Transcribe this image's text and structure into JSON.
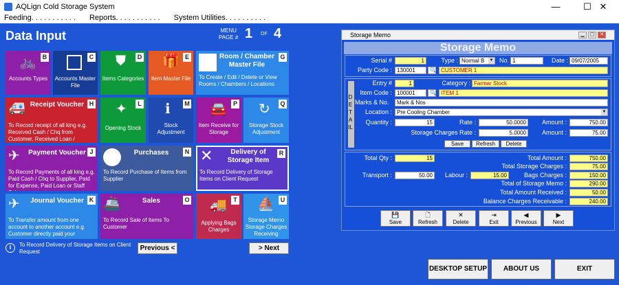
{
  "window": {
    "title": "AQLign Cold Storage System",
    "minimize": "—",
    "maximize": "☐",
    "close": "✕"
  },
  "menu": [
    "Feeding. . . . . . . . . . .",
    "Reports. . . . . . . . . . .",
    "System Utilities. . . . . . . . . ."
  ],
  "header": {
    "title": "Data Input",
    "menu_label": "MENU",
    "page_label": "PAGE #",
    "page_current": "1",
    "page_of": "OF",
    "page_total": "4"
  },
  "tiles": [
    {
      "key": "B",
      "label": "Accounts Types"
    },
    {
      "key": "C",
      "label": "Accounts Master File"
    },
    {
      "key": "D",
      "label": "Items Categories"
    },
    {
      "key": "E",
      "label": "Item Master File"
    },
    {
      "key": "G",
      "title": "Room / Chamber Master File",
      "desc": "To Create / Edit / Delete or View Rooms / Chambers / Locations"
    },
    {
      "key": "H",
      "title": "Receipt Voucher",
      "desc": "To Record receipt of all king e.g. Received Cash / Chq from Customer, Received Loan / Additional Income"
    },
    {
      "key": "L",
      "label": "Opening Stock"
    },
    {
      "key": "M",
      "label": "Stock Adjustment"
    },
    {
      "key": "P",
      "label": "Item Receive for Storage"
    },
    {
      "key": "Q",
      "label": "Storage Stock Adjustment"
    },
    {
      "key": "J",
      "title": "Payment Voucher",
      "desc": "To Record Payments of all king e.g. Paid Cash / Chq to Supplier, Paid for Expense, Paid Loan or Staff Salary"
    },
    {
      "key": "N",
      "title": "Purchases",
      "desc": "To Record Purchase of Items from Supplier"
    },
    {
      "key": "R",
      "title": "Delivery of Storage Item",
      "desc": "To Record Delivery of Storage Items on Client Request"
    },
    {
      "key": "K",
      "title": "Journal Voucher",
      "desc": "To Transfer amount from one account to another account e.g. Customer directly paid your"
    },
    {
      "key": "O",
      "title": "Sales",
      "desc": "To Record Sale of Items To Customer"
    },
    {
      "key": "T",
      "label": "Applying Bags Charges"
    },
    {
      "key": "U",
      "label": "Storage Memo Storage Charges Receiving"
    }
  ],
  "footnote": "To Record Delivery of Storage Items on Client Request",
  "nav": {
    "previous": "Previous <",
    "next": "> Next"
  },
  "bottom_buttons": {
    "desktop_setup": "DESKTOP SETUP",
    "about": "ABOUT US",
    "exit": "EXIT"
  },
  "memo": {
    "window_title": "Storage Memo",
    "banner": "Storage Memo",
    "labels": {
      "serial": "Serial #",
      "type": "Type :",
      "no": "No.",
      "date": "Date :",
      "party_code": "Party Code :",
      "detail": "DETAIL",
      "entry": "Entry #",
      "category": "Category :",
      "item_code": "Item Code :",
      "marks": "Marks & No.",
      "location": "Location :",
      "quantity": "Quantity :",
      "rate": "Rate :",
      "amount1": "Amount :",
      "storage_rate": "Storage Charges Rate :",
      "amount2": "Amount :",
      "total_qty": "Total Qty :",
      "total_amount": "Total Amount :",
      "total_storage_charges": "Total Storage Charges :",
      "transport": "Transport :",
      "labour": "Labour :",
      "bags_charges": "Bags Charges :",
      "total_storage_memo": "Total of Storage Memo :",
      "total_received": "Total Amount Received :",
      "balance": "Balance Charges Receivable :"
    },
    "values": {
      "serial": "1",
      "type": "Normal B",
      "no": "1",
      "date": "09/07/2005",
      "party_code": "130001",
      "customer": "CUSTOMER 1",
      "entry": "1",
      "category": "Farmar Stock",
      "item_code": "100001",
      "item_name": "ITEM 1",
      "marks": "Mark & Nos",
      "location": "Pre Cooling Chamber",
      "quantity": "15",
      "rate": "50.0000",
      "amount1": "750.00",
      "storage_rate": "5.0000",
      "amount2": "75.00",
      "total_qty": "15",
      "total_amount": "750.00",
      "total_storage_charges": "75.00",
      "transport": "50.00",
      "labour": "15.00",
      "bags_charges": "150.00",
      "total_storage_memo": "290.00",
      "total_received": "50.00",
      "balance": "240.00"
    },
    "detail_buttons": {
      "save": "Save",
      "refresh": "Refresh",
      "delete": "Delete"
    },
    "toolbar": [
      {
        "icon": "💾",
        "label": "Save"
      },
      {
        "icon": "🗋",
        "label": "Refresh"
      },
      {
        "icon": "✕",
        "label": "Delete"
      },
      {
        "icon": "⇥",
        "label": "Exit"
      },
      {
        "icon": "◀",
        "label": "Previous"
      },
      {
        "icon": "▶",
        "label": "Next"
      }
    ]
  }
}
